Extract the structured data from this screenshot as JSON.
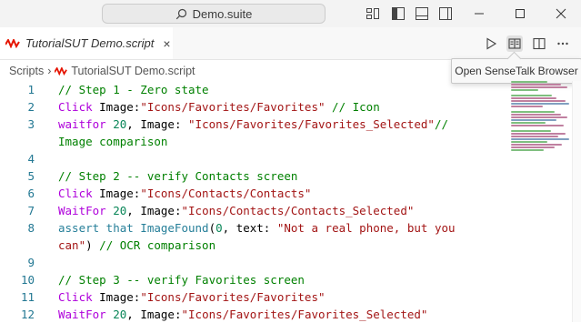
{
  "titlebar": {
    "search_text": "Demo.suite",
    "layout_icons": [
      "layout-customize-icon",
      "toggle-sidebar-icon",
      "toggle-panel-icon",
      "toggle-secondary-sidebar-icon"
    ],
    "window_controls": [
      "minimize-icon",
      "maximize-icon",
      "close-icon"
    ]
  },
  "tab": {
    "label": "TutorialSUT Demo.script",
    "close": "×"
  },
  "editor_actions": [
    "run-icon",
    "open-browser-icon",
    "split-editor-icon",
    "more-actions-icon"
  ],
  "breadcrumb": {
    "root": "Scripts",
    "separator": "›",
    "file": "TutorialSUT Demo.script"
  },
  "tooltip": {
    "text": "Open SenseTalk Browser"
  },
  "code": {
    "lines": [
      {
        "num": "1",
        "segments": [
          {
            "t": "// Step 1 - Zero state",
            "c": "c-comment"
          }
        ]
      },
      {
        "num": "2",
        "segments": [
          {
            "t": "Click ",
            "c": "c-cmd"
          },
          {
            "t": "Image:",
            "c": "c-plain"
          },
          {
            "t": "\"Icons/Favorites/Favorites\"",
            "c": "c-str"
          },
          {
            "t": " // Icon",
            "c": "c-comment"
          }
        ]
      },
      {
        "num": "3",
        "segments": [
          {
            "t": "waitfor ",
            "c": "c-cmd"
          },
          {
            "t": "20",
            "c": "c-num"
          },
          {
            "t": ", Image: ",
            "c": "c-plain"
          },
          {
            "t": "\"Icons/Favorites/Favorites_Selected\"",
            "c": "c-str"
          },
          {
            "t": "//",
            "c": "c-comment"
          }
        ]
      },
      {
        "num": "",
        "segments": [
          {
            "t": "Image comparison",
            "c": "c-comment"
          }
        ]
      },
      {
        "num": "4",
        "segments": []
      },
      {
        "num": "5",
        "segments": [
          {
            "t": "// Step 2 -- verify Contacts screen",
            "c": "c-comment"
          }
        ]
      },
      {
        "num": "6",
        "segments": [
          {
            "t": "Click ",
            "c": "c-cmd"
          },
          {
            "t": "Image:",
            "c": "c-plain"
          },
          {
            "t": "\"Icons/Contacts/Contacts\"",
            "c": "c-str"
          }
        ]
      },
      {
        "num": "7",
        "segments": [
          {
            "t": "WaitFor ",
            "c": "c-cmd"
          },
          {
            "t": "20",
            "c": "c-num"
          },
          {
            "t": ", Image:",
            "c": "c-plain"
          },
          {
            "t": "\"Icons/Contacts/Contacts_Selected\"",
            "c": "c-str"
          }
        ]
      },
      {
        "num": "8",
        "segments": [
          {
            "t": "assert that ImageFound",
            "c": "c-teal"
          },
          {
            "t": "(",
            "c": "c-plain"
          },
          {
            "t": "0",
            "c": "c-num"
          },
          {
            "t": ", text: ",
            "c": "c-plain"
          },
          {
            "t": "\"Not a real phone, but you",
            "c": "c-str"
          }
        ]
      },
      {
        "num": "",
        "segments": [
          {
            "t": "can\"",
            "c": "c-str"
          },
          {
            "t": ") ",
            "c": "c-plain"
          },
          {
            "t": "// OCR comparison",
            "c": "c-comment"
          }
        ]
      },
      {
        "num": "9",
        "segments": []
      },
      {
        "num": "10",
        "segments": [
          {
            "t": "// Step 3 -- verify Favorites screen",
            "c": "c-comment"
          }
        ]
      },
      {
        "num": "11",
        "segments": [
          {
            "t": "Click ",
            "c": "c-cmd"
          },
          {
            "t": "Image:",
            "c": "c-plain"
          },
          {
            "t": "\"Icons/Favorites/Favorites\"",
            "c": "c-str"
          }
        ]
      },
      {
        "num": "12",
        "segments": [
          {
            "t": "WaitFor ",
            "c": "c-cmd"
          },
          {
            "t": "20",
            "c": "c-num"
          },
          {
            "t": ", Image:",
            "c": "c-plain"
          },
          {
            "t": "\"Icons/Favorites/Favorites_Selected\"",
            "c": "c-str"
          }
        ]
      }
    ]
  },
  "colors": {
    "brand_logo": "#e51400",
    "line_number": "#237893",
    "comment": "#008000",
    "string": "#a31515",
    "command": "#af00db",
    "number": "#098658"
  }
}
